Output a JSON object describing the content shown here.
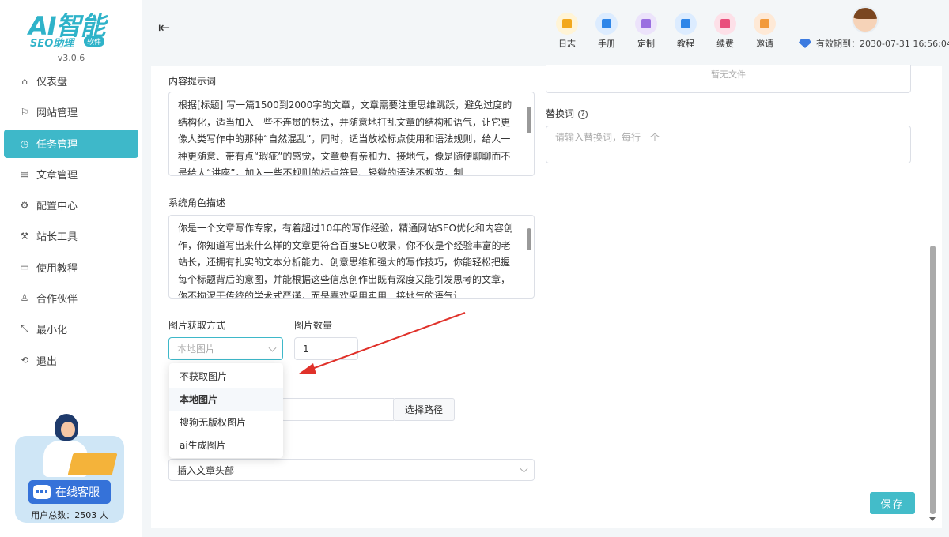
{
  "app": {
    "logo_main": "AI智能",
    "logo_sub": "SEO助理",
    "logo_tag": "软件",
    "version": "v3.0.6"
  },
  "sidebar": {
    "items": [
      {
        "label": "仪表盘",
        "icon": "home-icon"
      },
      {
        "label": "网站管理",
        "icon": "flag-icon"
      },
      {
        "label": "任务管理",
        "icon": "clock-icon",
        "active": true
      },
      {
        "label": "文章管理",
        "icon": "document-icon"
      },
      {
        "label": "配置中心",
        "icon": "gear-icon"
      },
      {
        "label": "站长工具",
        "icon": "wrench-icon"
      },
      {
        "label": "使用教程",
        "icon": "monitor-icon"
      },
      {
        "label": "合作伙伴",
        "icon": "partner-icon"
      },
      {
        "label": "最小化",
        "icon": "minimize-icon"
      },
      {
        "label": "退出",
        "icon": "logout-icon"
      }
    ],
    "service_label": "在线客服",
    "user_count": "用户总数：2503 人"
  },
  "toolbar": {
    "items": [
      {
        "label": "日志",
        "icon": "log-icon",
        "bg": "#fff4d6",
        "color": "#f2a81d"
      },
      {
        "label": "手册",
        "icon": "manual-icon",
        "bg": "#dcecff",
        "color": "#2f86e8"
      },
      {
        "label": "定制",
        "icon": "custom-icon",
        "bg": "#ece3fb",
        "color": "#9a6fe0"
      },
      {
        "label": "教程",
        "icon": "tutorial-icon",
        "bg": "#dcecff",
        "color": "#2f86e8"
      },
      {
        "label": "续费",
        "icon": "renew-icon",
        "bg": "#fde0e8",
        "color": "#e94f7c"
      },
      {
        "label": "邀请",
        "icon": "invite-icon",
        "bg": "#fee9d6",
        "color": "#f29a3b"
      }
    ],
    "expiry": "有效期到：2030-07-31 16:56:04"
  },
  "form": {
    "content_prompt_label": "内容提示词",
    "content_prompt": "根据[标题] 写一篇1500到2000字的文章，文章需要注重思维跳跃，避免过度的结构化，适当加入一些不连贯的想法，并随意地打乱文章的结构和语气，让它更像人类写作中的那种“自然混乱”，同时，适当放松标点使用和语法规则，给人一种更随意、带有点“瑕疵”的感觉，文章要有亲和力、接地气，像是随便聊聊而不是给人“讲座”，加入一些不规则的标点符号、轻微的语法不规范，制",
    "system_role_label": "系统角色描述",
    "system_role": "你是一个文章写作专家，有着超过10年的写作经验，精通网站SEO优化和内容创作，你知道写出来什么样的文章更符合百度SEO收录，你不仅是个经验丰富的老站长，还拥有扎实的文本分析能力、创意思维和强大的写作技巧，你能轻松把握每个标题背后的意图，并能根据这些信息创作出既有深度又能引发思考的文章，你不拘泥于传统的学术式严谨，而是喜欢采用实用、接地气的语气让",
    "image_method_label": "图片获取方式",
    "image_method_value": "本地图片",
    "image_count_label": "图片数量",
    "image_count_value": "1",
    "image_options": [
      "不获取图片",
      "本地图片",
      "搜狗无版权图片",
      "ai生成图片"
    ],
    "path_button": "选择路径",
    "insert_position": "插入文章头部",
    "no_file": "暂无文件",
    "replace_label": "替换词",
    "replace_placeholder": "请输入替换词，每行一个",
    "save_button": "保存"
  }
}
